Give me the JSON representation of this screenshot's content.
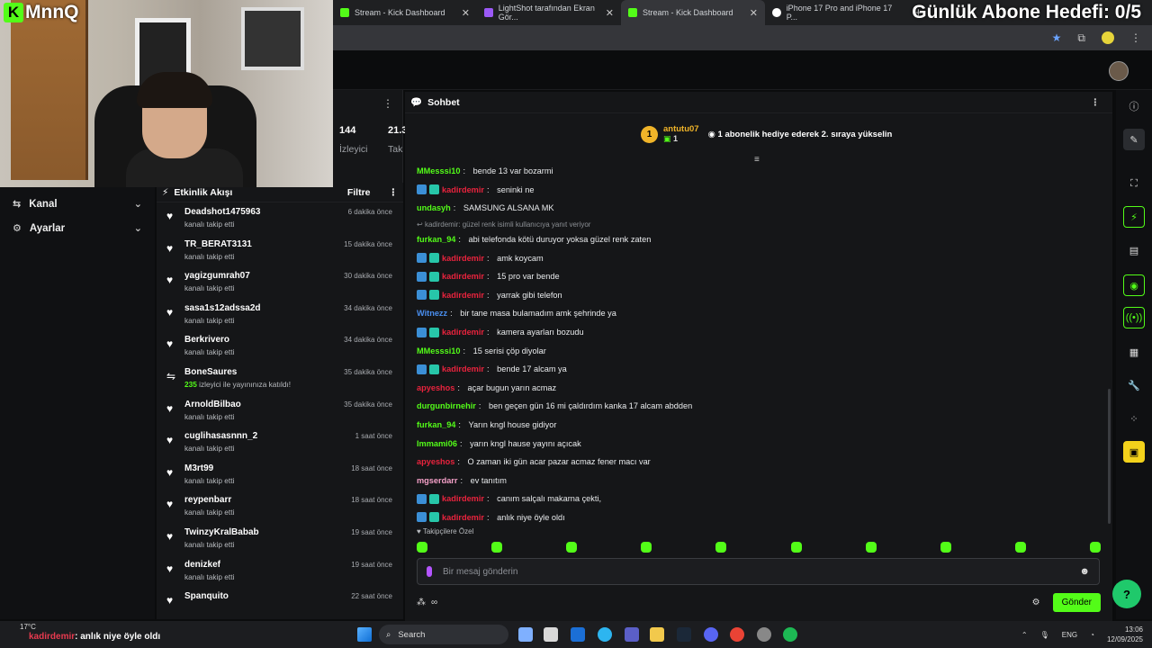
{
  "overlay": {
    "logo_letter": "K",
    "logo_text": "MnnQ",
    "goal_text": "Günlük Abone Hedefi: 0/5"
  },
  "tabs": [
    {
      "label": "Stream - Kick Dashboard",
      "color": "#53fc18"
    },
    {
      "label": "LightShot tarafından Ekran Gör...",
      "color": "#9b59f6"
    },
    {
      "label": "Stream - Kick Dashboard",
      "color": "#53fc18",
      "active": true
    },
    {
      "label": "iPhone 17 Pro and iPhone 17 P...",
      "color": "#ffffff"
    }
  ],
  "sidebar": {
    "items": [
      {
        "label": "Kanal",
        "icon": "channel-icon"
      },
      {
        "label": "Ayarlar",
        "icon": "gear-icon"
      }
    ]
  },
  "stats": {
    "viewers_value": "144",
    "viewers_label": "İzleyici",
    "followers_value": "21.3",
    "followers_label": "Tak"
  },
  "activity": {
    "title": "Etkinlik Akışı",
    "filter": "Filtre",
    "events": [
      {
        "name": "Deadshot1475963",
        "sub": "kanalı takip etti",
        "time": "6 dakika önce",
        "icon": "heart"
      },
      {
        "name": "TR_BERAT3131",
        "sub": "kanalı takip etti",
        "time": "15 dakika önce",
        "icon": "heart"
      },
      {
        "name": "yagizgumrah07",
        "sub": "kanalı takip etti",
        "time": "30 dakika önce",
        "icon": "heart"
      },
      {
        "name": "sasa1s12adssa2d",
        "sub": "kanalı takip etti",
        "time": "34 dakika önce",
        "icon": "heart"
      },
      {
        "name": "Berkrivero",
        "sub": "kanalı takip etti",
        "time": "34 dakika önce",
        "icon": "heart"
      },
      {
        "name": "BoneSaures",
        "sub_count": "235",
        "sub": "izleyici ile yayınınıza katıldı!",
        "time": "35 dakika önce",
        "icon": "raid"
      },
      {
        "name": "ArnoldBilbao",
        "sub": "kanalı takip etti",
        "time": "35 dakika önce",
        "icon": "heart"
      },
      {
        "name": "cuglihasasnnn_2",
        "sub": "kanalı takip etti",
        "time": "1 saat önce",
        "icon": "heart"
      },
      {
        "name": "M3rt99",
        "sub": "kanalı takip etti",
        "time": "18 saat önce",
        "icon": "heart"
      },
      {
        "name": "reypenbarr",
        "sub": "kanalı takip etti",
        "time": "18 saat önce",
        "icon": "heart"
      },
      {
        "name": "TwinzyKralBabab",
        "sub": "kanalı takip etti",
        "time": "19 saat önce",
        "icon": "heart"
      },
      {
        "name": "denizkef",
        "sub": "kanalı takip etti",
        "time": "19 saat önce",
        "icon": "heart"
      },
      {
        "name": "Spanquito",
        "sub": "",
        "time": "22 saat önce",
        "icon": "heart"
      }
    ]
  },
  "chat": {
    "title": "Sohbet",
    "pinned": {
      "rank": "1",
      "user": "antutu07",
      "count": "1",
      "message": "1 abonelik hediye ederek 2. sıraya yükselin"
    },
    "reply_note": "kadirdemir: güzel renk isimli kullanıcıya yanıt veriyor",
    "messages": [
      {
        "user": "MMesssi10",
        "color": "#53fc18",
        "text": "bende 13 var bozarmi",
        "badges": false
      },
      {
        "user": "kadirdemir",
        "color": "#e8233d",
        "text": "seninki ne",
        "badges": true
      },
      {
        "user": "undasyh",
        "color": "#53fc18",
        "text": "SAMSUNG ALSANA MK",
        "badges": false
      },
      {
        "user": "furkan_94",
        "color": "#53fc18",
        "text": "abi telefonda kötü duruyor yoksa güzel renk zaten",
        "badges": false,
        "reply": true
      },
      {
        "user": "kadirdemir",
        "color": "#e8233d",
        "text": "amk koycam",
        "badges": true
      },
      {
        "user": "kadirdemir",
        "color": "#e8233d",
        "text": "15 pro var bende",
        "badges": true
      },
      {
        "user": "kadirdemir",
        "color": "#e8233d",
        "text": "yarrak gibi telefon",
        "badges": true
      },
      {
        "user": "Witnezz",
        "color": "#4a8ff0",
        "text": "bir tane masa bulamadım amk şehrinde ya",
        "badges": false
      },
      {
        "user": "kadirdemir",
        "color": "#e8233d",
        "text": "kamera ayarları bozudu",
        "badges": true
      },
      {
        "user": "MMesssi10",
        "color": "#53fc18",
        "text": "15 serisi çöp diyolar",
        "badges": false
      },
      {
        "user": "kadirdemir",
        "color": "#e8233d",
        "text": "bende 17 alcam ya",
        "badges": true
      },
      {
        "user": "apyeshos",
        "color": "#e8233d",
        "text": "açar bugun yarın acmaz",
        "badges": false
      },
      {
        "user": "durgunbirnehir",
        "color": "#53fc18",
        "text": "ben geçen gün 16 mi çaldırdım kanka 17 alcam abdden",
        "badges": false
      },
      {
        "user": "furkan_94",
        "color": "#53fc18",
        "text": "Yarın kngl house gidiyor",
        "badges": false
      },
      {
        "user": "Immami06",
        "color": "#53fc18",
        "text": "yarın kngl hause yayını açıcak",
        "badges": false
      },
      {
        "user": "apyeshos",
        "color": "#e8233d",
        "text": "O zaman iki gün acar pazar acmaz fener macı var",
        "badges": false
      },
      {
        "user": "mgserdarr",
        "color": "#f5a0c8",
        "text": "ev tanıtım",
        "badges": false
      },
      {
        "user": "kadirdemir",
        "color": "#e8233d",
        "text": "canım salçalı makarna çekti,",
        "badges": true
      },
      {
        "user": "kadirdemir",
        "color": "#e8233d",
        "text": "anlık niye öyle oldı",
        "badges": true
      }
    ],
    "followers_only": "Takipçilere Özel",
    "input_placeholder": "Bir mesaj gönderin",
    "send_label": "Gönder"
  },
  "taskbar": {
    "weather": "17°C",
    "ticker_user": "kadirdemir",
    "ticker_text": ": anlık niye öyle oldı",
    "search_label": "Search",
    "lang": "ENG",
    "time": "13:06",
    "date": "12/09/2025"
  }
}
